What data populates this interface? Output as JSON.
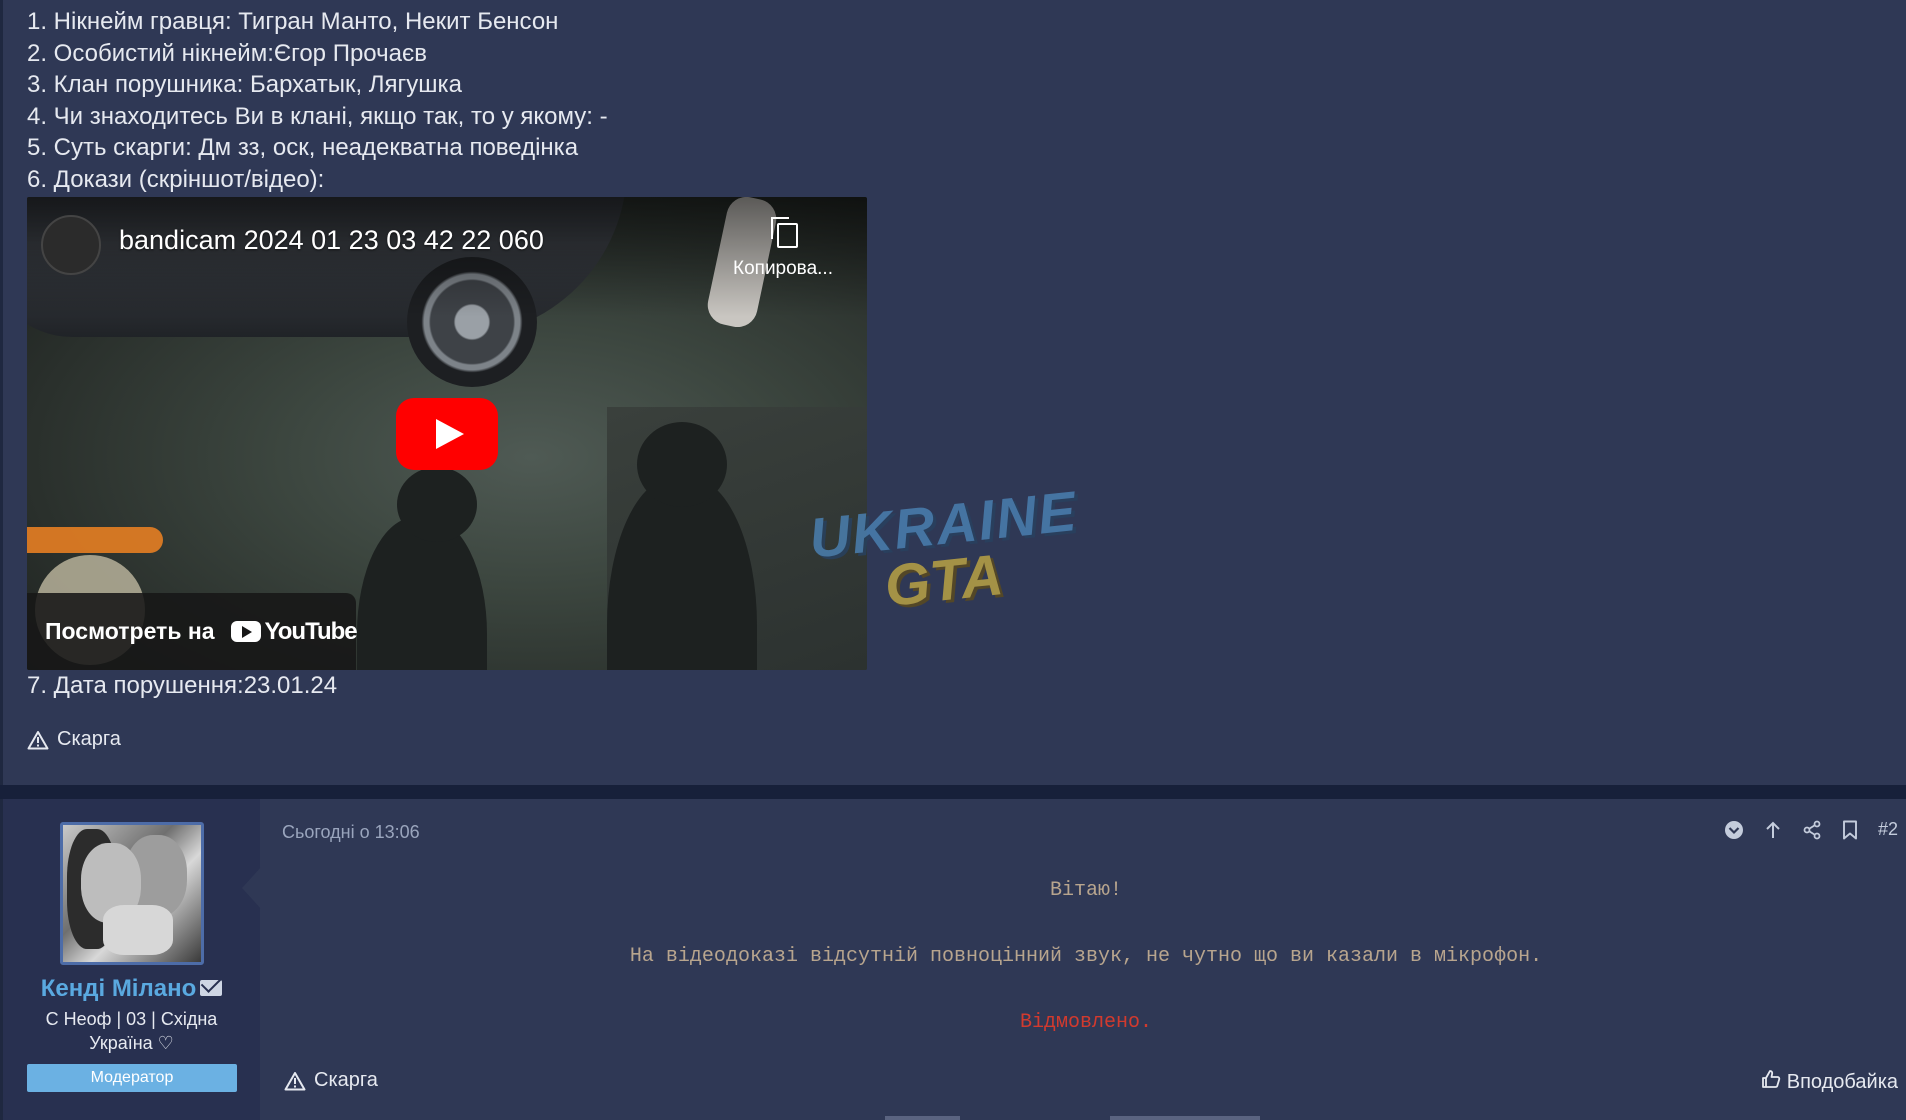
{
  "post1": {
    "lines": [
      "1. Нікнейм гравця: Тигран Манто, Некит Бенсон",
      "2. Особистий нікнейм:Єгор Прочаєв",
      "3. Клан порушника: Бархатык, Лягушка",
      "4. Чи знаходитесь Ви в клані, якщо так, то у якому: -",
      "5. Суть скарги: Дм зз, оск, неадекватна поведінка",
      "6. Докази (скріншот/відео):"
    ],
    "video": {
      "title": "bandicam 2024 01 23 03 42 22 060",
      "copy_label": "Копирова...",
      "watch_on": "Посмотреть на",
      "youtube": "YouTube"
    },
    "watermark": {
      "line1": "UKRAINE",
      "line2": "GTA"
    },
    "date_line": "7. Дата порушення:23.01.24",
    "report_label": "Скарга"
  },
  "post2": {
    "user": {
      "name": "Кенді Мілано",
      "title": "С Неоф | 03 | Східна Україна ♡",
      "role": "Модератор"
    },
    "meta": {
      "time": "Сьогодні о 13:06",
      "post_number": "#2"
    },
    "content": {
      "greeting": "Вітаю!",
      "message": "На відеодоказі відсутній повноцінний звук, не чутно що ви казали в мікрофон.",
      "verdict": "Відмовлено."
    },
    "report_label": "Скарга",
    "like_label": "Вподобайка"
  },
  "colors": {
    "background": "#2f3855",
    "username": "#5aa9e0",
    "role_badge": "#6bb1e3",
    "verdict": "#d23a2e",
    "message": "#b8a58e"
  },
  "icons": [
    "warning-icon",
    "copy-icon",
    "play-icon",
    "youtube-icon",
    "mail-icon",
    "chevron-down-icon",
    "arrow-up-icon",
    "share-icon",
    "bookmark-icon",
    "thumbs-up-icon"
  ]
}
